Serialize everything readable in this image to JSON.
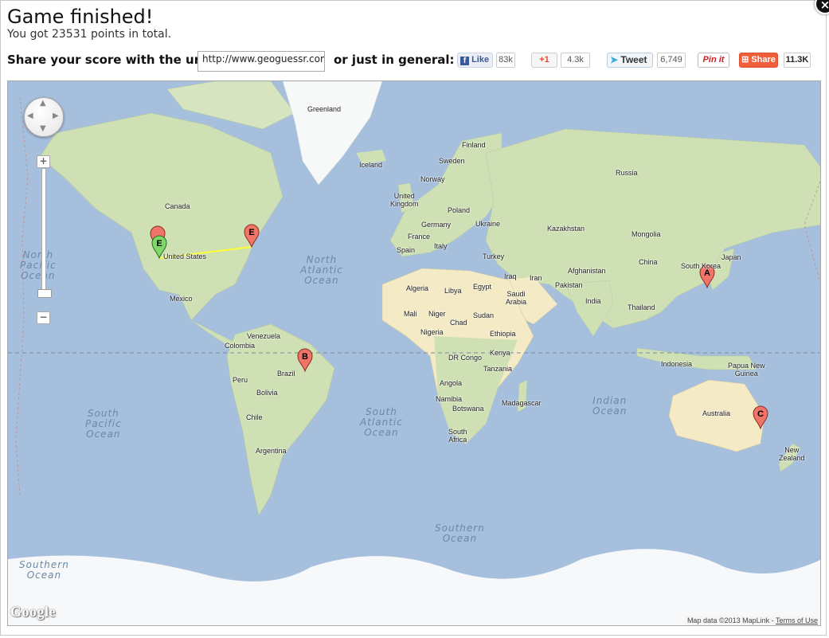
{
  "header": {
    "title": "Game finished!",
    "subtitle": "You got 23531 points in total."
  },
  "share": {
    "url_label": "Share your score with the url:",
    "url_value": "http://www.geoguessr.com",
    "general_label": "or just in general:",
    "facebook": {
      "label": "Like",
      "count": "83k"
    },
    "googleplus": {
      "label": "+1",
      "count": "4.3k"
    },
    "twitter": {
      "label": "Tweet",
      "count": "6,749"
    },
    "pinterest": {
      "label": "Pin it"
    },
    "addthis": {
      "label": "Share",
      "count": "11.3K"
    }
  },
  "close_label": "×",
  "map": {
    "labels": {
      "greenland": "Greenland",
      "iceland": "Iceland",
      "finland": "Finland",
      "sweden": "Sweden",
      "norway": "Norway",
      "russia": "Russia",
      "united_kingdom": "United\nKingdom",
      "poland": "Poland",
      "germany": "Germany",
      "ukraine": "Ukraine",
      "france": "France",
      "kazakhstan": "Kazakhstan",
      "mongolia": "Mongolia",
      "spain": "Spain",
      "italy": "Italy",
      "turkey": "Turkey",
      "china": "China",
      "south_korea": "South Korea",
      "japan": "Japan",
      "algeria": "Algeria",
      "libya": "Libya",
      "egypt": "Egypt",
      "iraq": "Iraq",
      "iran": "Iran",
      "afghanistan": "Afghanistan",
      "pakistan": "Pakistan",
      "saudi_arabia": "Saudi\nArabia",
      "india": "India",
      "thailand": "Thailand",
      "mali": "Mali",
      "niger": "Niger",
      "chad": "Chad",
      "sudan": "Sudan",
      "nigeria": "Nigeria",
      "ethiopia": "Ethiopia",
      "kenya": "Kenya",
      "dr_congo": "DR Congo",
      "tanzania": "Tanzania",
      "angola": "Angola",
      "namibia": "Namibia",
      "botswana": "Botswana",
      "madagascar": "Madagascar",
      "south_africa": "South\nAfrica",
      "indonesia": "Indonesia",
      "papua_new_guinea": "Papua New\nGuinea",
      "australia": "Australia",
      "new_zealand": "New\nZealand",
      "canada": "Canada",
      "united_states": "United States",
      "mexico": "Mexico",
      "venezuela": "Venezuela",
      "colombia": "Colombia",
      "peru": "Peru",
      "brazil": "Brazil",
      "bolivia": "Bolivia",
      "chile": "Chile",
      "argentina": "Argentina"
    },
    "oceans": {
      "north_pacific": "North\nPacific\nOcean",
      "north_atlantic": "North\nAtlantic\nOcean",
      "south_pacific": "South\nPacific\nOcean",
      "south_atlantic": "South\nAtlantic\nOcean",
      "indian": "Indian\nOcean",
      "southern_1": "Southern\nOcean",
      "southern_2": "Southern\nOcean"
    },
    "markers": [
      {
        "letter": "A",
        "color": "#f07468"
      },
      {
        "letter": "B",
        "color": "#f07468"
      },
      {
        "letter": "C",
        "color": "#f07468"
      },
      {
        "letter": "E",
        "color": "#f07468"
      },
      {
        "letter": "E",
        "color": "#7ed96a"
      }
    ],
    "zoom_in": "+",
    "zoom_out": "−",
    "google_logo": "Google",
    "attribution": "Map data ©2013 MapLink - ",
    "terms": "Terms of Use",
    "ocean_color": "#a5bfdd",
    "land_color": "#cfe1b4",
    "guess_line_color": "#ffff33"
  }
}
